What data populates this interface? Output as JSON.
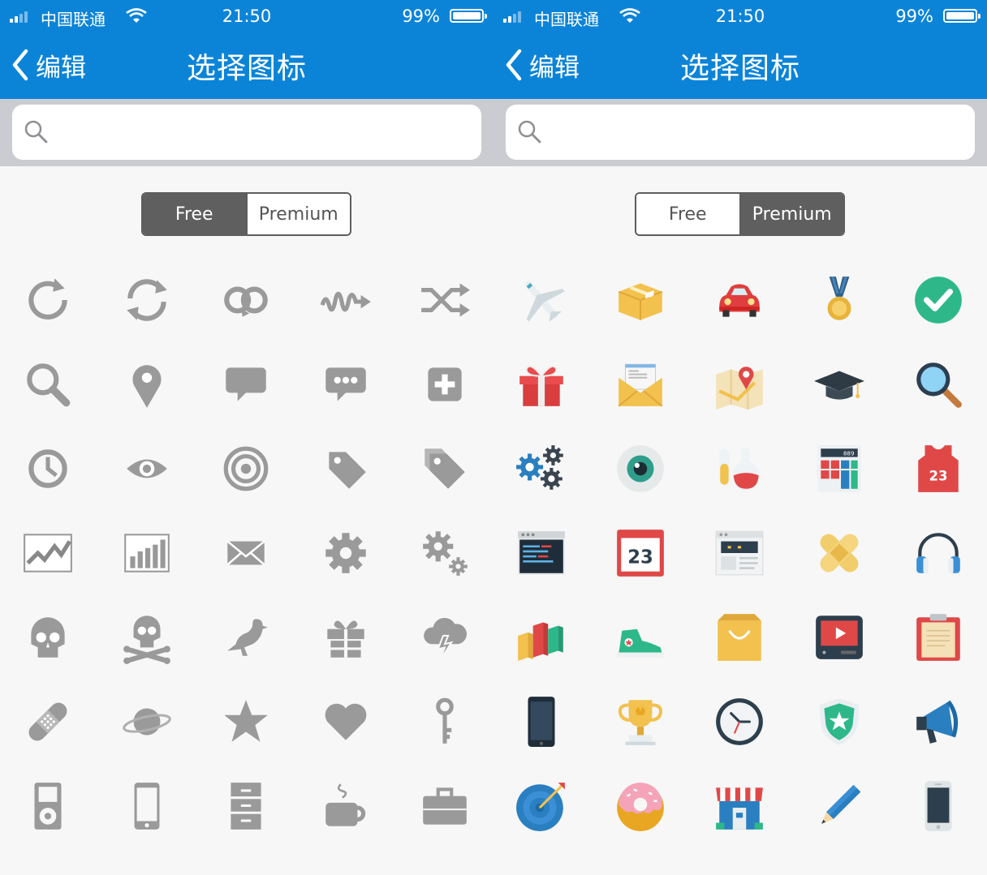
{
  "screens": [
    {
      "status": {
        "carrier": "中国联通",
        "time": "21:50",
        "battery": "99%"
      },
      "nav": {
        "back_label": "编辑",
        "title": "选择图标"
      },
      "search": {
        "placeholder": ""
      },
      "segment": {
        "options": [
          "Free",
          "Premium"
        ],
        "selected": "Free"
      },
      "icons": [
        "refresh-icon",
        "sync-icon",
        "loop-icon",
        "squiggle-arrow-icon",
        "shuffle-icon",
        "search-icon",
        "map-pin-icon",
        "speech-bubble-icon",
        "chat-dots-icon",
        "plus-square-icon",
        "clock-icon",
        "eye-icon",
        "target-icon",
        "tag-icon",
        "tags-icon",
        "line-chart-icon",
        "bar-chart-icon",
        "envelope-icon",
        "gear-icon",
        "gears-icon",
        "skull-icon",
        "skull-crossbones-icon",
        "pigeon-icon",
        "gift-icon",
        "storm-cloud-icon",
        "bandage-icon",
        "planet-icon",
        "star-icon",
        "heart-icon",
        "key-icon",
        "ipod-icon",
        "phone-icon",
        "cabinet-icon",
        "coffee-cup-icon",
        "briefcase-icon"
      ]
    },
    {
      "status": {
        "carrier": "中国联通",
        "time": "21:50",
        "battery": "99%"
      },
      "nav": {
        "back_label": "编辑",
        "title": "选择图标"
      },
      "search": {
        "placeholder": ""
      },
      "segment": {
        "options": [
          "Free",
          "Premium"
        ],
        "selected": "Premium"
      },
      "icons": [
        "airplane-icon",
        "package-box-icon",
        "car-icon",
        "medal-icon",
        "checkmark-circle-icon",
        "gift-box-icon",
        "mail-envelope-icon",
        "map-location-icon",
        "graduation-cap-icon",
        "magnifier-icon",
        "gears-icon",
        "eye-ball-icon",
        "lab-flasks-icon",
        "calculator-icon",
        "jersey-icon",
        "code-window-icon",
        "calendar-icon",
        "web-page-icon",
        "bandage-cross-icon",
        "headphones-icon",
        "bar-blocks-icon",
        "sneaker-icon",
        "shopping-bag-icon",
        "video-player-icon",
        "clipboard-icon",
        "smartphone-icon",
        "trophy-icon",
        "wall-clock-icon",
        "shield-star-icon",
        "megaphone-icon",
        "dartboard-icon",
        "donut-icon",
        "store-icon",
        "pencil-icon",
        "iphone-icon"
      ],
      "calc_display": "889",
      "jersey_number": "23",
      "calendar_day": "23"
    }
  ],
  "colors": {
    "nav_bg": "#0b84d8",
    "icon_gray": "#9a9a9a",
    "segment_active": "#5f5f5f"
  }
}
